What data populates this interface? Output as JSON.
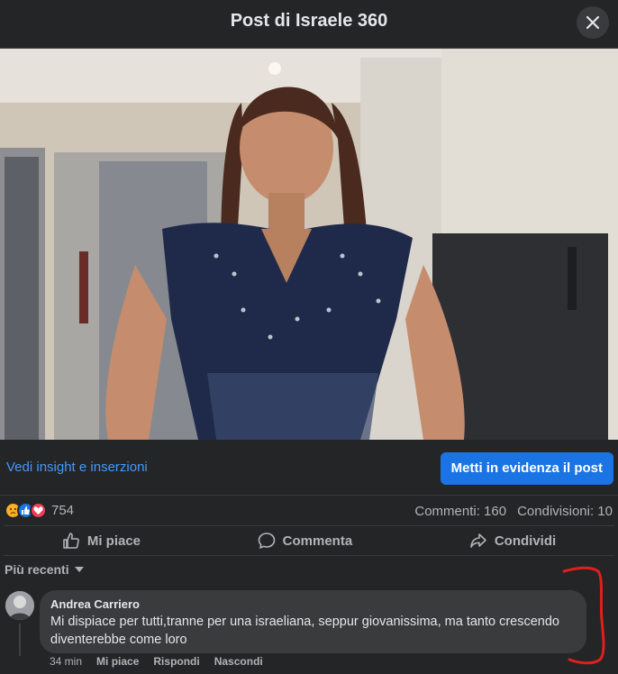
{
  "header": {
    "title": "Post di Israele 360"
  },
  "actions": {
    "insight_link": "Vedi insight e inserzioni",
    "boost_button": "Metti in evidenza il post"
  },
  "stats": {
    "reaction_count": "754",
    "comments": "Commenti: 160",
    "shares": "Condivisioni: 10",
    "reactions": [
      "sad-reaction",
      "like-reaction",
      "love-reaction"
    ]
  },
  "buttons": {
    "like": "Mi piace",
    "comment": "Commenta",
    "share": "Condividi"
  },
  "sort": {
    "label": "Più recenti"
  },
  "comment": {
    "author": "Andrea Carriero",
    "text": "Mi dispiace per tutti,tranne per una israeliana, seppur giovanissima, ma tanto crescendo diventerebbe come loro",
    "time": "34 min",
    "like": "Mi piace",
    "reply": "Rispondi",
    "hide": "Nascondi"
  },
  "colors": {
    "background": "#242526",
    "accent": "#1b74e4",
    "link": "#4599ff",
    "annotation": "#e0201b"
  }
}
